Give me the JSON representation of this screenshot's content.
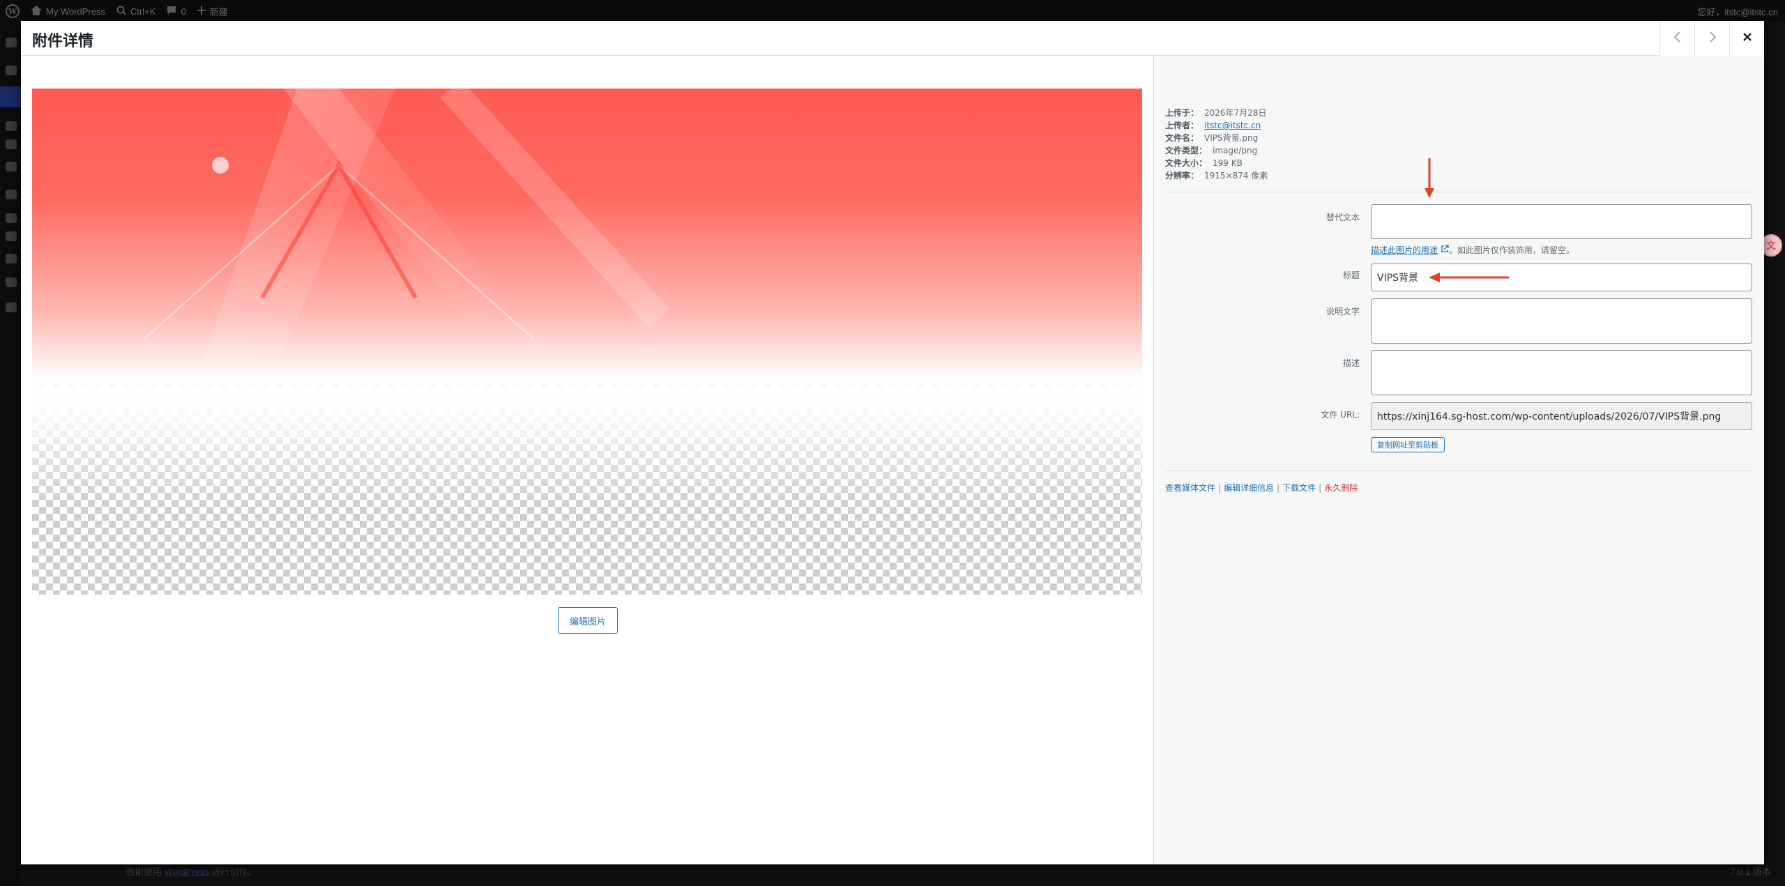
{
  "admin_bar": {
    "site_name": "My WordPress",
    "shortcut": "Ctrl+K",
    "comments_count": "0",
    "new_label": "新建",
    "greeting": "您好，itstc@itstc.cn"
  },
  "background": {
    "footer_prefix": "感谢使用",
    "footer_link": "WordPress",
    "footer_suffix": "进行创作。",
    "version": "7.0.1 版本"
  },
  "modal": {
    "title": "附件详情",
    "edit_image_button": "编辑图片"
  },
  "file_info": {
    "uploaded_on_label": "上传于：",
    "uploaded_on": "2026年7月28日",
    "uploaded_by_label": "上传者：",
    "uploaded_by": "itstc@itstc.cn",
    "file_name_label": "文件名：",
    "file_name": "VIPS背景.png",
    "file_type_label": "文件类型：",
    "file_type": "image/png",
    "file_size_label": "文件大小：",
    "file_size": "199 KB",
    "dimensions_label": "分辨率：",
    "dimensions": "1915×874 像素"
  },
  "fields": {
    "alt_label": "替代文本",
    "alt_value": "",
    "alt_help_link": "描述此图片的用途",
    "alt_help_suffix": "。如此图片仅作装饰用，请留空。",
    "title_label": "标题",
    "title_value": "VIPS背景",
    "caption_label": "说明文字",
    "caption_value": "",
    "description_label": "描述",
    "description_value": "",
    "url_label": "文件 URL:",
    "url_value": "https://xinj164.sg-host.com/wp-content/uploads/2026/07/VIPS背景.png",
    "copy_button": "复制网址至剪贴板"
  },
  "actions": {
    "view": "查看媒体文件",
    "edit": "编辑详细信息",
    "download": "下载文件",
    "delete": "永久删除"
  },
  "colors": {
    "accent": "#2271b1",
    "danger": "#d63638",
    "annotation_arrow": "#d9442b",
    "image_red": "#ff5650"
  }
}
